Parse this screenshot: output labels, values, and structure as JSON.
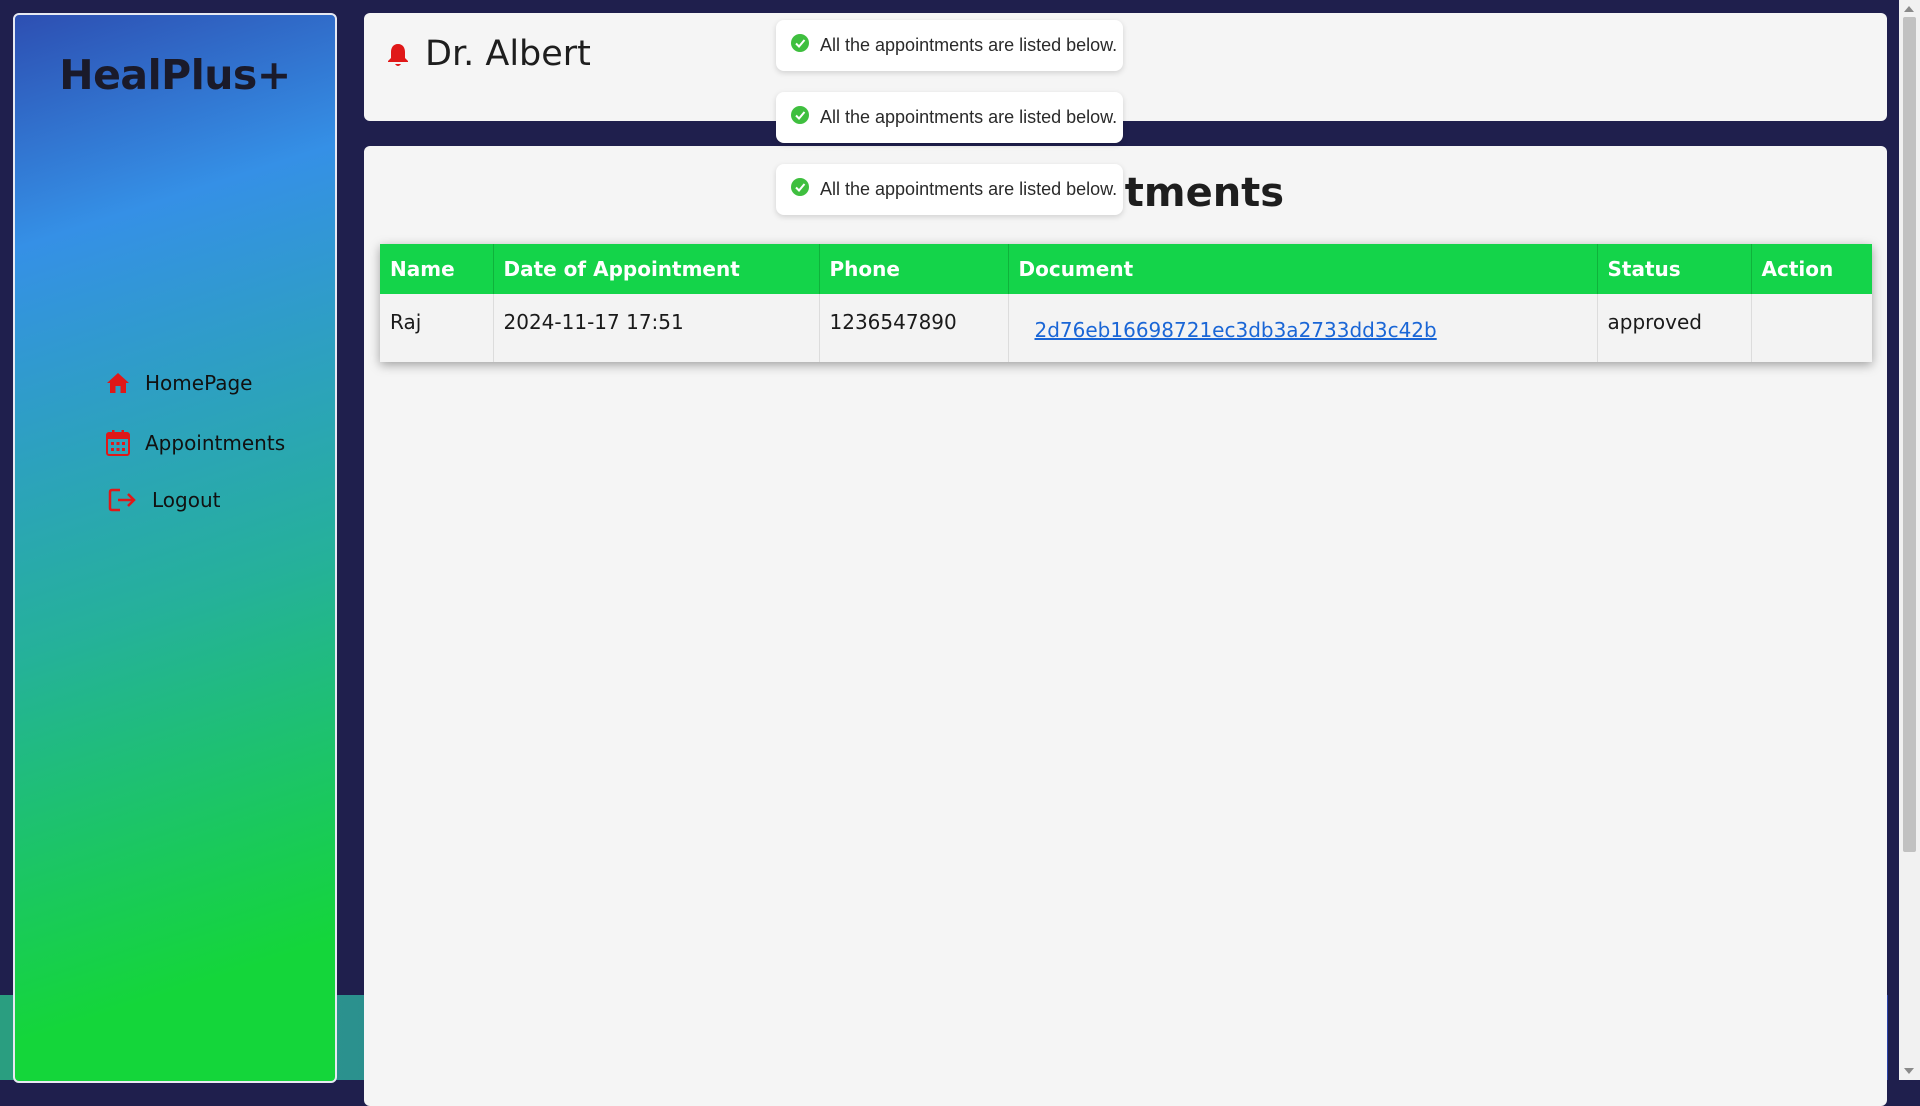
{
  "app": {
    "logo": "HealPlus+"
  },
  "sidebar": {
    "items": [
      {
        "label": "HomePage",
        "icon": "home-icon"
      },
      {
        "label": "Appointments",
        "icon": "calendar-icon"
      },
      {
        "label": "Logout",
        "icon": "logout-icon"
      }
    ]
  },
  "header": {
    "doctor_name": "Dr. Albert",
    "icon": "bell-icon"
  },
  "main": {
    "title": "Appointments",
    "table": {
      "columns": [
        "Name",
        "Date of Appointment",
        "Phone",
        "Document",
        "Status",
        "Action"
      ],
      "rows": [
        {
          "name": "Raj",
          "date": "2024-11-17 17:51",
          "phone": "1236547890",
          "document": "2d76eb16698721ec3db3a2733dd3c42b",
          "status": "approved",
          "action": ""
        }
      ]
    }
  },
  "toasts": [
    {
      "message": "All the appointments are listed below.",
      "icon": "check-circle-icon"
    },
    {
      "message": "All the appointments are listed below.",
      "icon": "check-circle-icon"
    },
    {
      "message": "All the appointments are listed below.",
      "icon": "check-circle-icon"
    }
  ],
  "colors": {
    "accent_green": "#14d44a",
    "icon_red": "#e01818",
    "link_blue": "#1a66d6",
    "toast_check": "#3fbf3f"
  }
}
